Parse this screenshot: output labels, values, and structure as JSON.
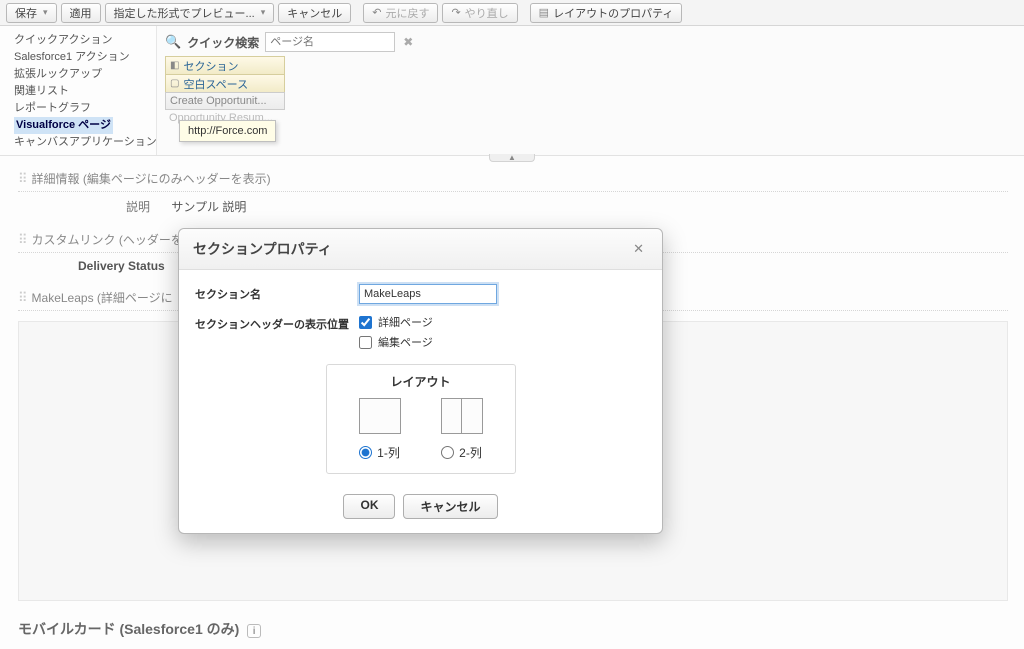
{
  "toolbar": {
    "save": "保存",
    "apply": "適用",
    "preview": "指定した形式でプレビュー...",
    "cancel": "キャンセル",
    "undo": "元に戻す",
    "redo": "やり直し",
    "layout_props": "レイアウトのプロパティ"
  },
  "sidebar": {
    "items": [
      "クイックアクション",
      "Salesforce1 アクション",
      "拡張ルックアップ",
      "関連リスト",
      "レポートグラフ",
      "Visualforce ページ",
      "キャンバスアプリケーション"
    ],
    "selected_index": 5
  },
  "search": {
    "label": "クイック検索",
    "placeholder": "ページ名"
  },
  "palette": {
    "section": "セクション",
    "blank": "空白スペース",
    "create_opp": "Create Opportunit...",
    "cutoff": "Opportunity Resum...",
    "tooltip": "http://Force.com"
  },
  "sections": {
    "detail_head": "詳細情報 (編集ページにのみヘッダーを表示)",
    "desc_label": "説明",
    "desc_value": "サンプル 説明",
    "custom_links_head": "カスタムリンク (ヘッダーを",
    "delivery_status": "Delivery Status",
    "makeleaps_head": "MakeLeaps (詳細ページに",
    "mobile_head": "モバイルカード (Salesforce1 のみ)"
  },
  "modal": {
    "title": "セクションプロパティ",
    "name_label": "セクション名",
    "name_value": "MakeLeaps",
    "header_pos_label": "セクションヘッダーの表示位置",
    "detail_page": "詳細ページ",
    "edit_page": "編集ページ",
    "layout_title": "レイアウト",
    "col1": "1-列",
    "col2": "2-列",
    "ok": "OK",
    "cancel": "キャンセル"
  }
}
